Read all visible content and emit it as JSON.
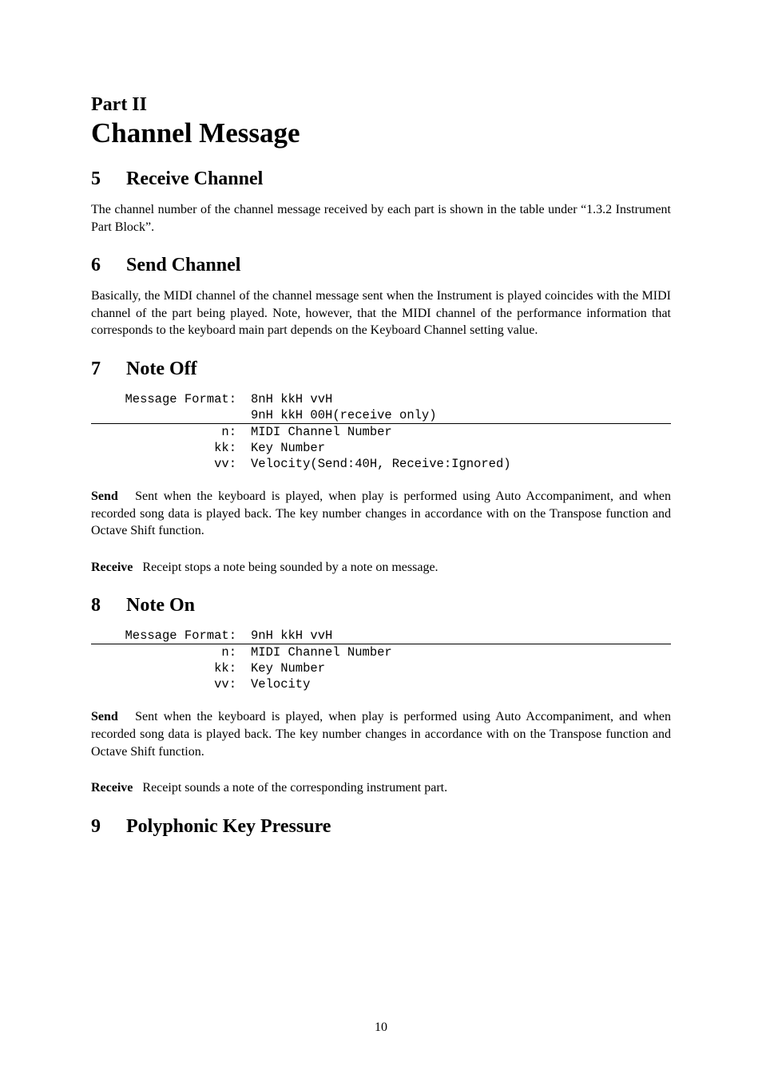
{
  "part": {
    "label": "Part II",
    "title": "Channel Message"
  },
  "s5": {
    "num": "5",
    "title": "Receive Channel",
    "body": "The channel number of the channel message received by each part is shown in the table under “1.3.2 Instrument Part Block”."
  },
  "s6": {
    "num": "6",
    "title": "Send Channel",
    "body": "Basically, the MIDI channel of the channel message sent when the Instrument is played coincides with the MIDI channel of the part being played. Note, however, that the MIDI channel of the performance information that corresponds to the keyboard main part depends on the Keyboard Channel setting value."
  },
  "s7": {
    "num": "7",
    "title": "Note Off",
    "table": {
      "fmt_label": "Message Format:",
      "fmt1": "8nH kkH vvH",
      "fmt2": "9nH kkH 00H(receive only)",
      "n_label": "n:",
      "n": "MIDI Channel Number",
      "kk_label": "kk:",
      "kk": "Key Number",
      "vv_label": "vv:",
      "vv": "Velocity(Send:40H, Receive:Ignored)"
    },
    "send_label": "Send",
    "send": "Sent when the keyboard is played, when play is performed using Auto Accompaniment, and when recorded song data is played back. The key number changes in accordance with on the Transpose function and Octave Shift function.",
    "recv_label": "Receive",
    "recv": "Receipt stops a note being sounded by a note on message."
  },
  "s8": {
    "num": "8",
    "title": "Note On",
    "table": {
      "fmt_label": "Message Format:",
      "fmt1": "9nH kkH vvH",
      "n_label": "n:",
      "n": "MIDI Channel Number",
      "kk_label": "kk:",
      "kk": "Key Number",
      "vv_label": "vv:",
      "vv": "Velocity"
    },
    "send_label": "Send",
    "send": "Sent when the keyboard is played, when play is performed using Auto Accompaniment, and when recorded song data is played back. The key number changes in accordance with on the Transpose function and Octave Shift function.",
    "recv_label": "Receive",
    "recv": "Receipt sounds a note of the corresponding instrument part."
  },
  "s9": {
    "num": "9",
    "title": "Polyphonic Key Pressure"
  },
  "page_number": "10"
}
